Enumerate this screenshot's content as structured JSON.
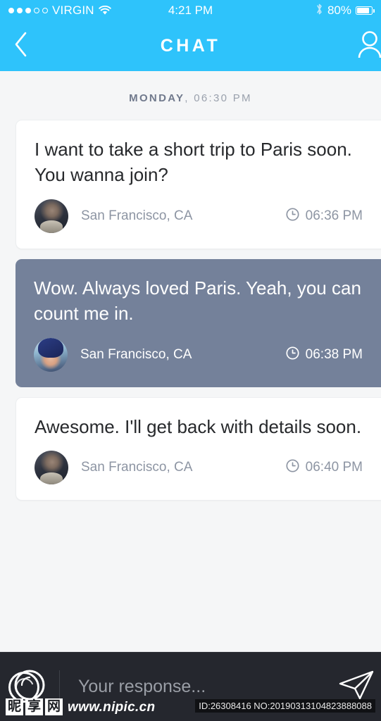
{
  "status_bar": {
    "carrier": "VIRGIN",
    "signal_dots_filled": 3,
    "signal_dots_total": 5,
    "wifi_icon": "wifi-icon",
    "time": "4:21 PM",
    "bluetooth_icon": "bluetooth-icon",
    "battery_percent": "80%",
    "battery_icon": "battery-icon"
  },
  "header": {
    "back_icon": "chevron-left-icon",
    "title": "CHAT",
    "contact_icon": "person-icon",
    "background_color": "#2ec3fb"
  },
  "conversation": {
    "date_divider": {
      "day": "MONDAY",
      "time": ", 06:30 PM"
    },
    "messages": [
      {
        "text": "I want to take a short trip to Paris soon. You wanna join?",
        "location": "San Francisco, CA",
        "time": "06:36 PM",
        "direction": "incoming",
        "avatar": "male-avatar",
        "clock_icon": "clock-icon",
        "bubble_color": "#ffffff"
      },
      {
        "text": "Wow. Always loved Paris. Yeah, you can count me in.",
        "location": "San Francisco, CA",
        "time": "06:38 PM",
        "direction": "outgoing",
        "avatar": "female-avatar",
        "clock_icon": "clock-icon",
        "bubble_color": "#74819a"
      },
      {
        "text": "Awesome. I'll get back with details soon.",
        "location": "San Francisco, CA",
        "time": "06:40 PM",
        "direction": "incoming",
        "avatar": "male-avatar",
        "clock_icon": "clock-icon",
        "bubble_color": "#ffffff"
      }
    ]
  },
  "composer": {
    "attach_icon": "camera-circle-icon",
    "placeholder": "Your response...",
    "value": "",
    "send_icon": "paper-plane-icon",
    "background_color": "#25272e"
  },
  "watermark": {
    "cn_chars": [
      "昵",
      "享",
      "网"
    ],
    "url": "www.nipic.cn",
    "id_text": "ID:26308416 NO:20190313104823888088",
    "logo_icon": "ring-logo-icon"
  }
}
